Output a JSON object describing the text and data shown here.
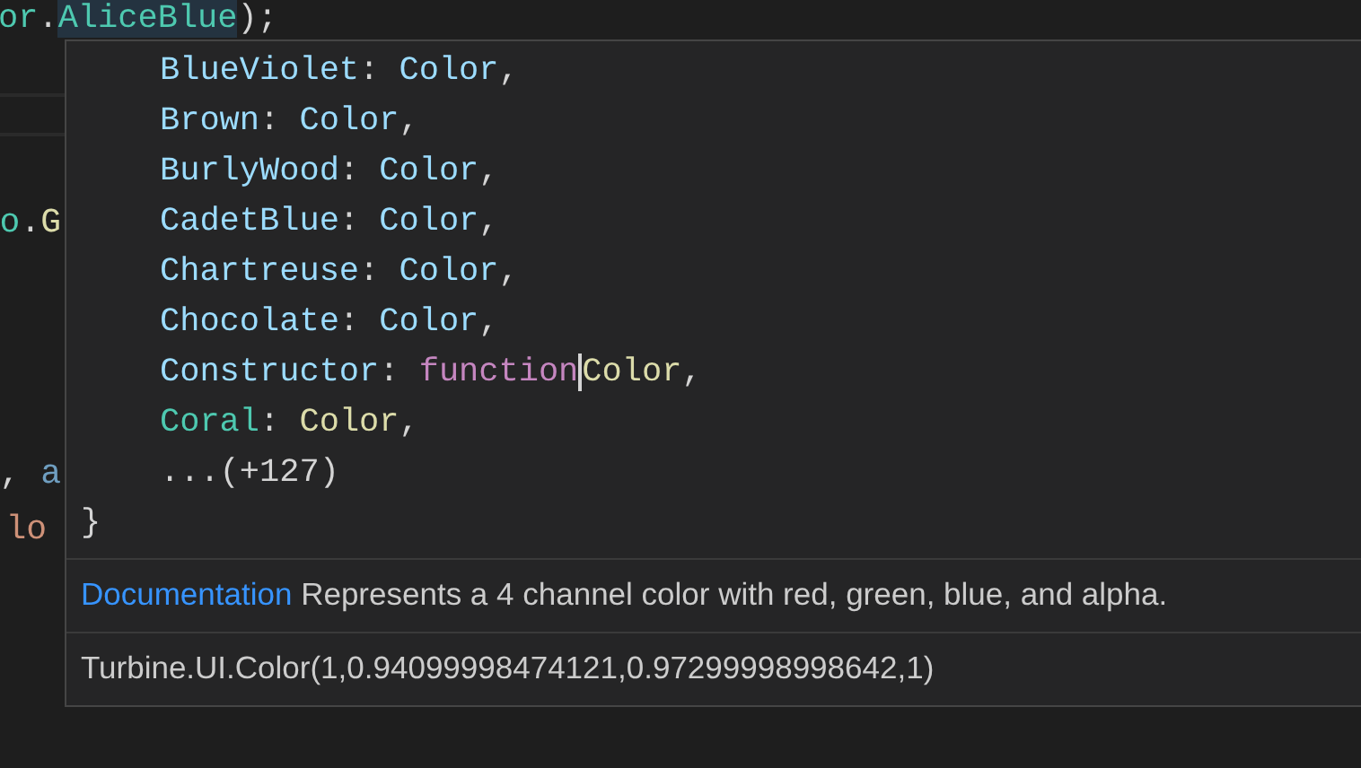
{
  "editor": {
    "top_line": [
      {
        "text": "or",
        "kind": "class"
      },
      {
        "text": ".",
        "kind": "punct"
      },
      {
        "text": "AliceBlue",
        "kind": "class",
        "highlighted": true
      },
      {
        "text": ");",
        "kind": "punct"
      }
    ],
    "gutter_fragments": [
      {
        "segments": [
          {
            "text": "o",
            "kind": "class"
          },
          {
            "text": ".",
            "kind": "punct"
          },
          {
            "text": "G",
            "kind": "function"
          }
        ]
      },
      {
        "segments": [
          {
            "text": ", ",
            "kind": "punct"
          },
          {
            "text": "a",
            "kind": "param"
          }
        ]
      },
      {
        "segments": [
          {
            "text": "lo",
            "kind": "string"
          }
        ]
      }
    ]
  },
  "hover": {
    "code_lines": [
      {
        "segments": [
          {
            "text": "BlueViolet",
            "kind": "property"
          },
          {
            "text": ": ",
            "kind": "punct"
          },
          {
            "text": "Color",
            "kind": "property"
          },
          {
            "text": ",",
            "kind": "punct"
          }
        ]
      },
      {
        "segments": [
          {
            "text": "Brown",
            "kind": "property"
          },
          {
            "text": ": ",
            "kind": "punct"
          },
          {
            "text": "Color",
            "kind": "property"
          },
          {
            "text": ",",
            "kind": "punct"
          }
        ]
      },
      {
        "segments": [
          {
            "text": "BurlyWood",
            "kind": "property"
          },
          {
            "text": ": ",
            "kind": "punct"
          },
          {
            "text": "Color",
            "kind": "property"
          },
          {
            "text": ",",
            "kind": "punct"
          }
        ]
      },
      {
        "segments": [
          {
            "text": "CadetBlue",
            "kind": "property"
          },
          {
            "text": ": ",
            "kind": "punct"
          },
          {
            "text": "Color",
            "kind": "property"
          },
          {
            "text": ",",
            "kind": "punct"
          }
        ]
      },
      {
        "segments": [
          {
            "text": "Chartreuse",
            "kind": "property"
          },
          {
            "text": ": ",
            "kind": "punct"
          },
          {
            "text": "Color",
            "kind": "property"
          },
          {
            "text": ",",
            "kind": "punct"
          }
        ]
      },
      {
        "segments": [
          {
            "text": "Chocolate",
            "kind": "property"
          },
          {
            "text": ": ",
            "kind": "punct"
          },
          {
            "text": "Color",
            "kind": "property"
          },
          {
            "text": ",",
            "kind": "punct"
          }
        ]
      },
      {
        "segments": [
          {
            "text": "Constructor",
            "kind": "property"
          },
          {
            "text": ": ",
            "kind": "punct"
          },
          {
            "text": "function",
            "kind": "keyword"
          },
          {
            "text": "Color",
            "kind": "function",
            "caret_before": true
          },
          {
            "text": ",",
            "kind": "punct"
          }
        ]
      },
      {
        "segments": [
          {
            "text": "Coral",
            "kind": "class"
          },
          {
            "text": ": ",
            "kind": "punct"
          },
          {
            "text": "Color",
            "kind": "function"
          },
          {
            "text": ",",
            "kind": "punct"
          }
        ]
      },
      {
        "segments": [
          {
            "text": "...(+127)",
            "kind": "punct"
          }
        ]
      }
    ],
    "closing_brace": "}",
    "documentation_link": "Documentation",
    "documentation_text": "Represents a 4 channel color with red, green, blue, and alpha.",
    "value": "Turbine.UI.Color(1,0.94099998474121,0.97299998998642,1)"
  }
}
